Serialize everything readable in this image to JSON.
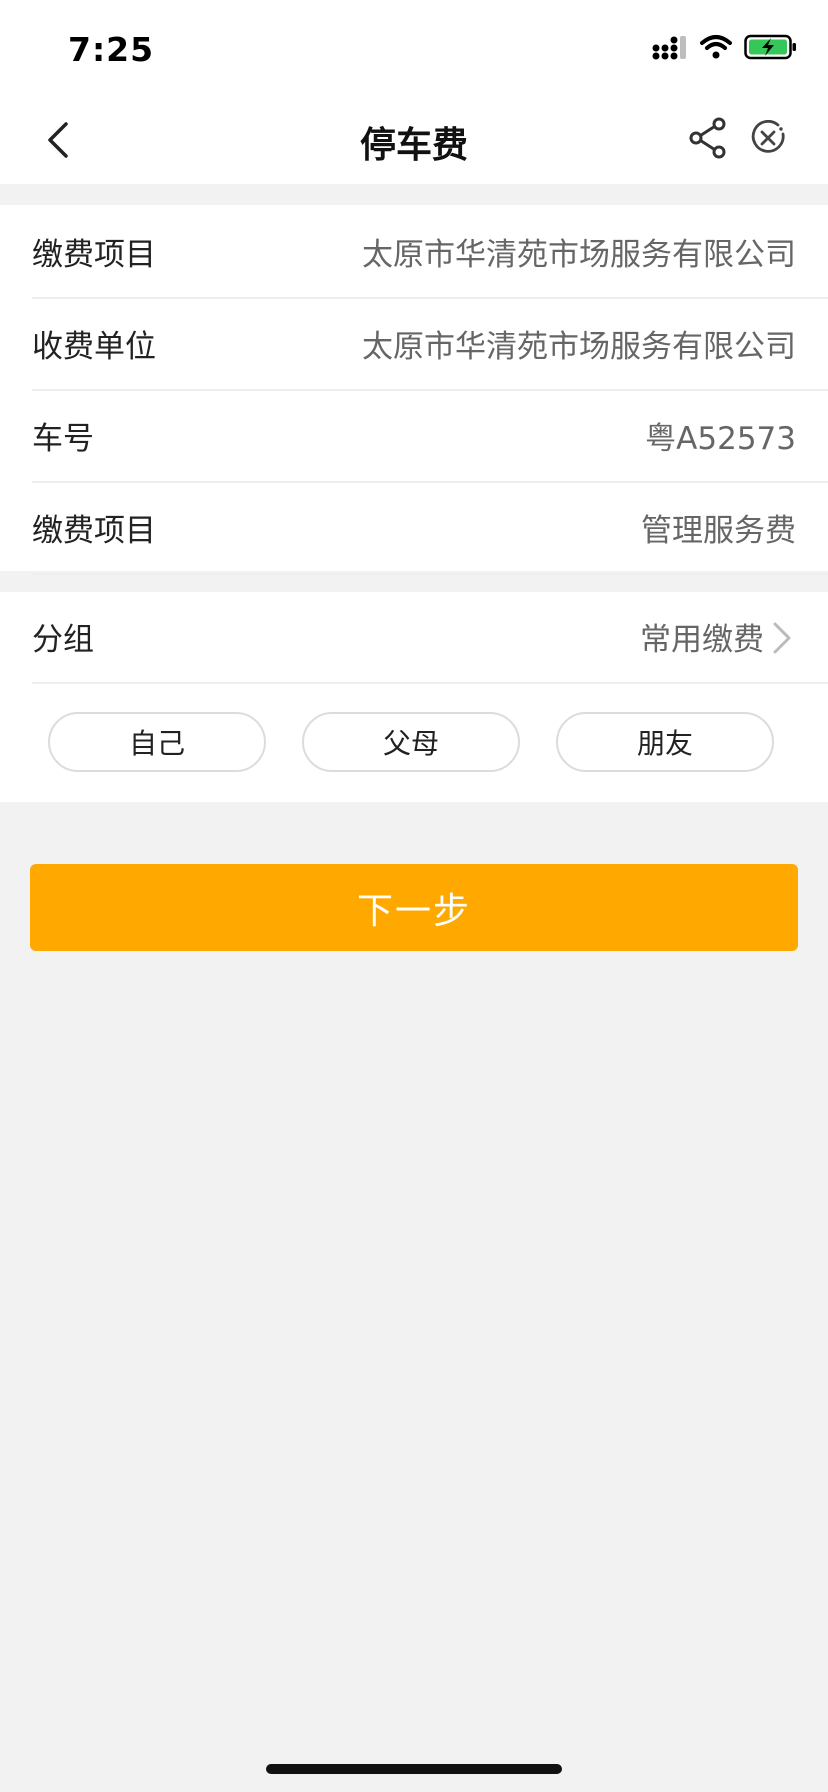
{
  "status_bar": {
    "time": "7:25"
  },
  "nav": {
    "title": "停车费"
  },
  "details": [
    {
      "label": "缴费项目",
      "value": "太原市华清苑市场服务有限公司"
    },
    {
      "label": "收费单位",
      "value": "太原市华清苑市场服务有限公司"
    },
    {
      "label": "车号",
      "value": "粤A52573"
    },
    {
      "label": "缴费项目",
      "value": "管理服务费"
    }
  ],
  "group": {
    "label": "分组",
    "value": "常用缴费",
    "chips": [
      "自己",
      "父母",
      "朋友"
    ]
  },
  "next_button": {
    "label": "下一步"
  },
  "colors": {
    "accent": "#ffa800",
    "background": "#f2f2f2"
  }
}
